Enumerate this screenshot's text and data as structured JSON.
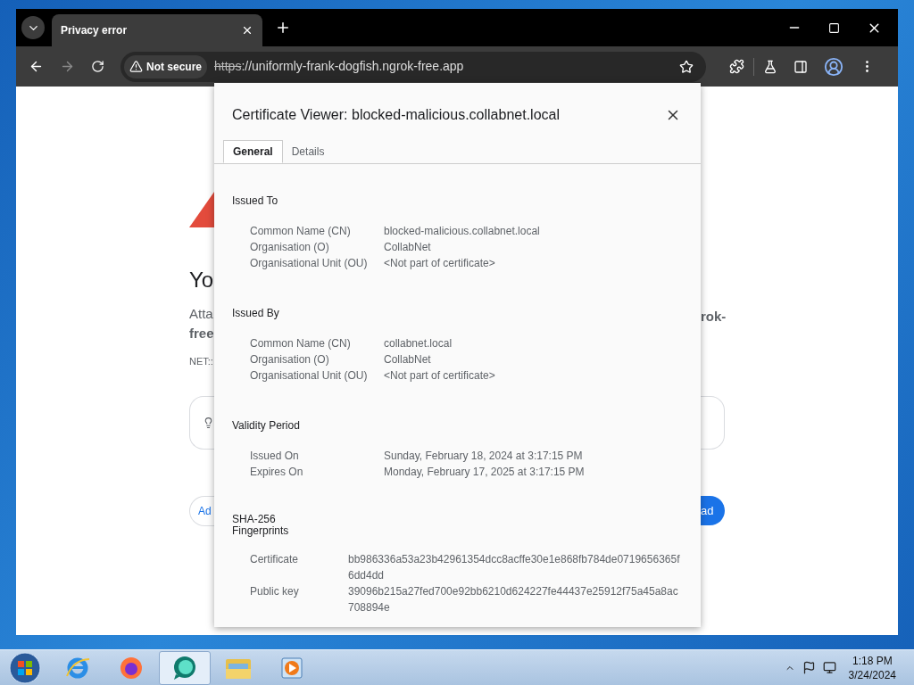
{
  "browser": {
    "tab": {
      "title": "Privacy error"
    },
    "address": {
      "security": "Not secure",
      "scheme": "https",
      "rest": "://uniformly-frank-dogfish.ngrok-free.app"
    }
  },
  "page": {
    "heading": "Yo",
    "left_text": [
      "Atta",
      "free"
    ],
    "right_text": "rok-",
    "code": "NET::",
    "secondary_button": "Ad",
    "primary_button": "ad"
  },
  "dialog": {
    "title": "Certificate Viewer: blocked-malicious.collabnet.local",
    "tabs": [
      {
        "label": "General",
        "selected": true
      },
      {
        "label": "Details",
        "selected": false
      }
    ],
    "sections": [
      {
        "heading": "Issued To",
        "kind": "fields",
        "rows": [
          {
            "label": "Common Name (CN)",
            "value": "blocked-malicious.collabnet.local"
          },
          {
            "label": "Organisation (O)",
            "value": "CollabNet"
          },
          {
            "label": "Organisational Unit (OU)",
            "value": "<Not part of certificate>"
          }
        ]
      },
      {
        "heading": "Issued By",
        "kind": "fields",
        "rows": [
          {
            "label": "Common Name (CN)",
            "value": "collabnet.local"
          },
          {
            "label": "Organisation (O)",
            "value": "CollabNet"
          },
          {
            "label": "Organisational Unit (OU)",
            "value": "<Not part of certificate>"
          }
        ]
      },
      {
        "heading": "Validity Period",
        "kind": "fields",
        "rows": [
          {
            "label": "Issued On",
            "value": "Sunday, February 18, 2024 at 3:17:15 PM"
          },
          {
            "label": "Expires On",
            "value": "Monday, February 17, 2025 at 3:17:15 PM"
          }
        ]
      },
      {
        "heading": "SHA-256 Fingerprints",
        "kind": "hashes",
        "rows": [
          {
            "label": "Certificate",
            "value": "bb986336a53a23b42961354dcc8acffe30e1e868fb784de0719656365f6dd4dd"
          },
          {
            "label": "Public key",
            "value": "39096b215a27fed700e92bb6210d624227fe44437e25912f75a45a8ac708894e"
          }
        ]
      }
    ]
  },
  "taskbar": {
    "apps": [
      {
        "kind": "ie",
        "selected": false
      },
      {
        "kind": "firefox",
        "selected": false
      },
      {
        "kind": "chat",
        "selected": true
      },
      {
        "kind": "folder",
        "selected": false
      },
      {
        "kind": "media",
        "selected": false
      }
    ],
    "time": "1:18 PM",
    "date": "3/24/2024"
  }
}
